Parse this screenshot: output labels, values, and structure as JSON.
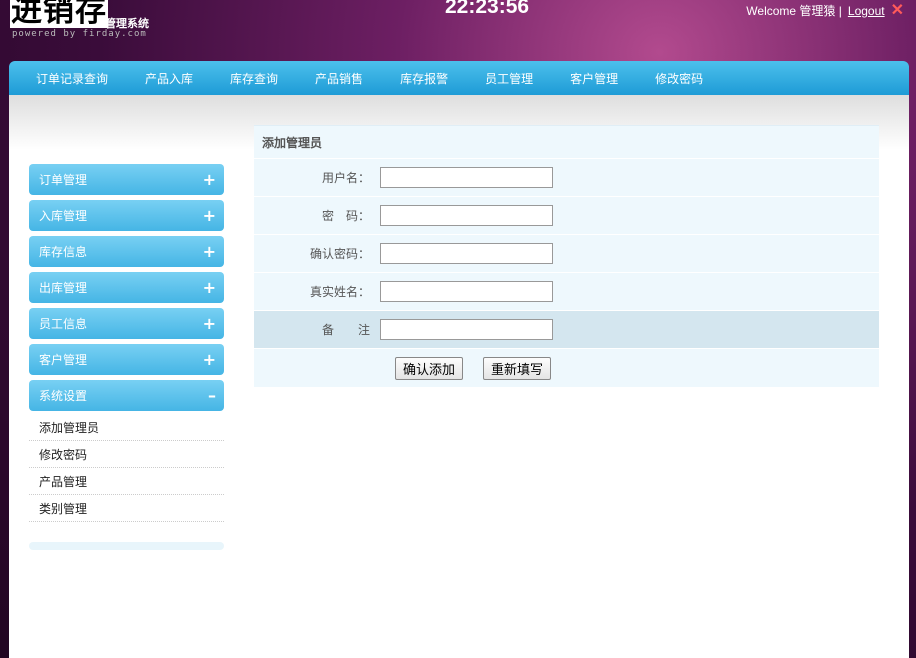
{
  "header": {
    "logo_text": "进销存",
    "logo_sub": "管理系统",
    "powered_by": "powered by firday.com",
    "clock": "22:23:56",
    "welcome": "Welcome 管理猿 |",
    "logout": "Logout"
  },
  "nav": {
    "items": [
      {
        "label": "订单记录查询"
      },
      {
        "label": "产品入库"
      },
      {
        "label": "库存查询"
      },
      {
        "label": "产品销售"
      },
      {
        "label": "库存报警"
      },
      {
        "label": "员工管理"
      },
      {
        "label": "客户管理"
      },
      {
        "label": "修改密码"
      }
    ]
  },
  "sidebar": {
    "groups": [
      {
        "label": "订单管理",
        "toggle": "+"
      },
      {
        "label": "入库管理",
        "toggle": "+"
      },
      {
        "label": "库存信息",
        "toggle": "+"
      },
      {
        "label": "出库管理",
        "toggle": "+"
      },
      {
        "label": "员工信息",
        "toggle": "+"
      },
      {
        "label": "客户管理",
        "toggle": "+"
      },
      {
        "label": "系统设置",
        "toggle": "–"
      }
    ],
    "sub_items": [
      {
        "label": "添加管理员"
      },
      {
        "label": "修改密码"
      },
      {
        "label": "产品管理"
      },
      {
        "label": "类别管理"
      }
    ]
  },
  "form": {
    "title": "添加管理员",
    "fields": [
      {
        "label": "用户名：",
        "value": ""
      },
      {
        "label": "密　码：",
        "value": ""
      },
      {
        "label": "确认密码：",
        "value": ""
      },
      {
        "label": "真实姓名：",
        "value": ""
      },
      {
        "label": "备　　注",
        "value": ""
      }
    ],
    "submit_label": "确认添加",
    "reset_label": "重新填写"
  },
  "colors": {
    "nav_bar": "#1e9bd6",
    "sidebar_head": "#45b5e5",
    "form_bg": "#eef8fd",
    "form_alt_row": "#d4e6ef",
    "logout_x": "#ff5a5a"
  }
}
